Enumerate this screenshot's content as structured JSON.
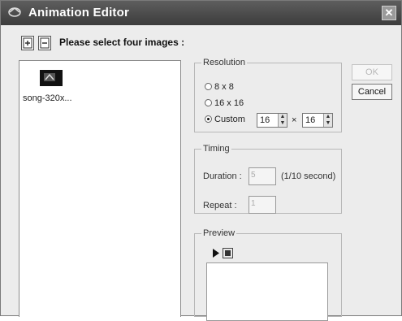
{
  "window": {
    "title": "Animation Editor",
    "close_glyph": "✕"
  },
  "toolbar": {
    "add_icon": "add-image-icon",
    "remove_icon": "remove-image-icon",
    "prompt": "Please select four images :"
  },
  "image_list": {
    "items": [
      {
        "label": "song-320x..."
      }
    ]
  },
  "resolution": {
    "legend": "Resolution",
    "options": [
      "8 x 8",
      "16 x 16",
      "Custom"
    ],
    "selected": "Custom",
    "custom_width": "16",
    "custom_height": "16",
    "times_glyph": "×"
  },
  "timing": {
    "legend": "Timing",
    "duration_label": "Duration :",
    "duration_value": "5",
    "duration_unit": "(1/10 second)",
    "repeat_label": "Repeat :",
    "repeat_value": "1"
  },
  "preview": {
    "legend": "Preview"
  },
  "buttons": {
    "ok": "OK",
    "cancel": "Cancel"
  },
  "colors": {
    "titlebar": "#4a4a4a",
    "background": "#ececec"
  }
}
